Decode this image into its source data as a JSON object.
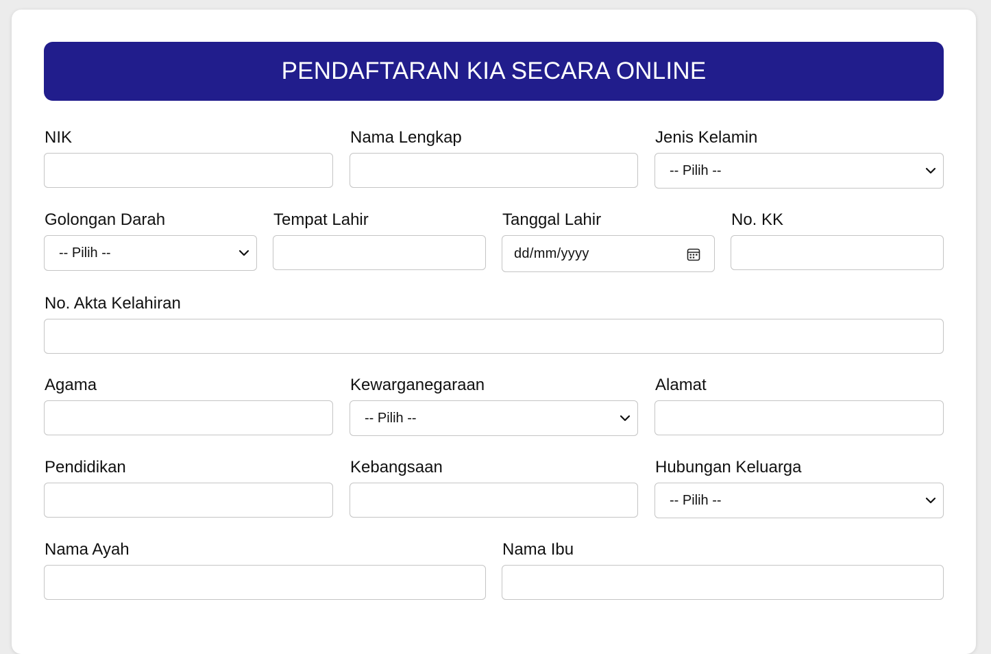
{
  "header": {
    "title": "PENDAFTARAN KIA SECARA ONLINE"
  },
  "form": {
    "nik": {
      "label": "NIK",
      "value": ""
    },
    "nama_lengkap": {
      "label": "Nama Lengkap",
      "value": ""
    },
    "jenis_kelamin": {
      "label": "Jenis Kelamin",
      "selected": "-- Pilih --"
    },
    "golongan_darah": {
      "label": "Golongan Darah",
      "selected": "-- Pilih --"
    },
    "tempat_lahir": {
      "label": "Tempat Lahir",
      "value": ""
    },
    "tanggal_lahir": {
      "label": "Tanggal Lahir",
      "placeholder": "dd/mm/yyyy"
    },
    "no_kk": {
      "label": "No. KK",
      "value": ""
    },
    "no_akta": {
      "label": "No. Akta Kelahiran",
      "value": ""
    },
    "agama": {
      "label": "Agama",
      "value": ""
    },
    "kewarganegaraan": {
      "label": "Kewarganegaraan",
      "selected": "-- Pilih --"
    },
    "alamat": {
      "label": "Alamat",
      "value": ""
    },
    "pendidikan": {
      "label": "Pendidikan",
      "value": ""
    },
    "kebangsaan": {
      "label": "Kebangsaan",
      "value": ""
    },
    "hubungan_keluarga": {
      "label": "Hubungan Keluarga",
      "selected": "-- Pilih --"
    },
    "nama_ayah": {
      "label": "Nama Ayah",
      "value": ""
    },
    "nama_ibu": {
      "label": "Nama Ibu",
      "value": ""
    }
  },
  "icons": {
    "select": "chevron-down-icon",
    "date": "calendar-icon"
  },
  "colors": {
    "banner": "#211d8c",
    "banner_text": "#ffffff",
    "border": "#c4c4c4"
  }
}
